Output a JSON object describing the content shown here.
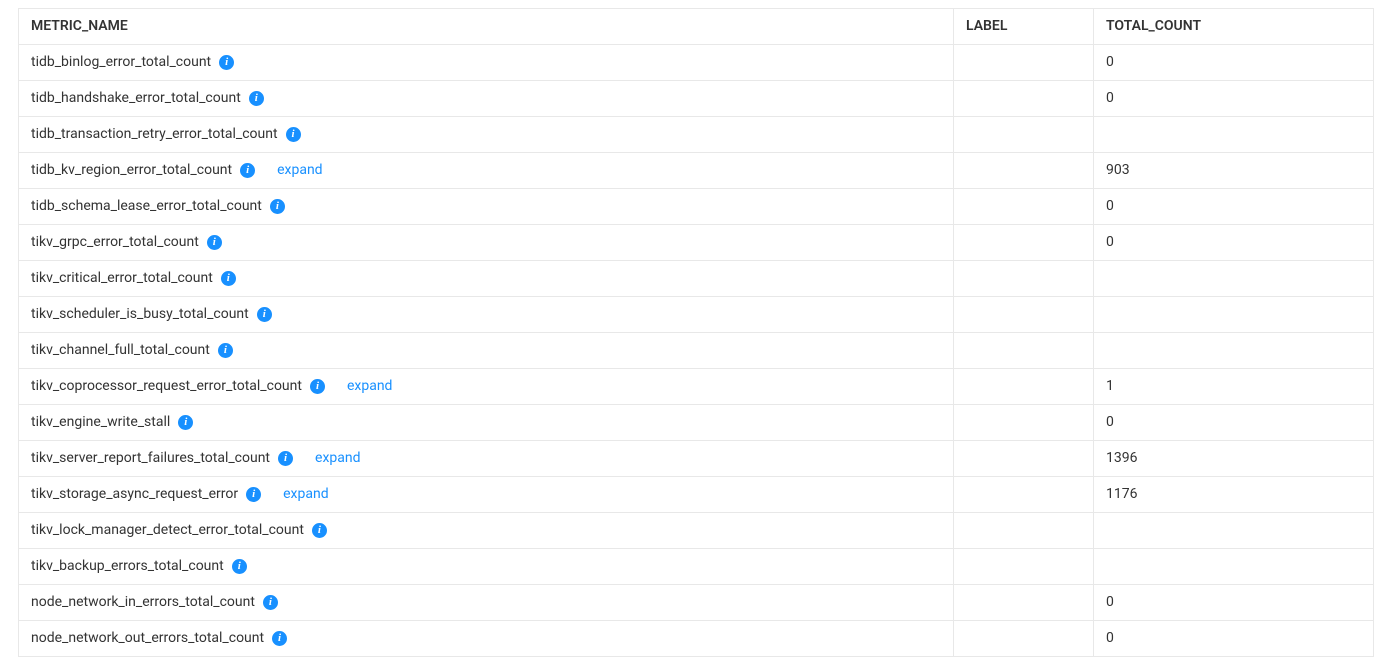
{
  "header": {
    "metric_name": "METRIC_NAME",
    "label": "LABEL",
    "total_count": "TOTAL_COUNT"
  },
  "expand_label": "expand",
  "rows": [
    {
      "metric": "tidb_binlog_error_total_count",
      "label": "",
      "count": "0",
      "expand": false
    },
    {
      "metric": "tidb_handshake_error_total_count",
      "label": "",
      "count": "0",
      "expand": false
    },
    {
      "metric": "tidb_transaction_retry_error_total_count",
      "label": "",
      "count": "",
      "expand": false
    },
    {
      "metric": "tidb_kv_region_error_total_count",
      "label": "",
      "count": "903",
      "expand": true
    },
    {
      "metric": "tidb_schema_lease_error_total_count",
      "label": "",
      "count": "0",
      "expand": false
    },
    {
      "metric": "tikv_grpc_error_total_count",
      "label": "",
      "count": "0",
      "expand": false
    },
    {
      "metric": "tikv_critical_error_total_count",
      "label": "",
      "count": "",
      "expand": false
    },
    {
      "metric": "tikv_scheduler_is_busy_total_count",
      "label": "",
      "count": "",
      "expand": false
    },
    {
      "metric": "tikv_channel_full_total_count",
      "label": "",
      "count": "",
      "expand": false
    },
    {
      "metric": "tikv_coprocessor_request_error_total_count",
      "label": "",
      "count": "1",
      "expand": true
    },
    {
      "metric": "tikv_engine_write_stall",
      "label": "",
      "count": "0",
      "expand": false
    },
    {
      "metric": "tikv_server_report_failures_total_count",
      "label": "",
      "count": "1396",
      "expand": true
    },
    {
      "metric": "tikv_storage_async_request_error",
      "label": "",
      "count": "1176",
      "expand": true
    },
    {
      "metric": "tikv_lock_manager_detect_error_total_count",
      "label": "",
      "count": "",
      "expand": false
    },
    {
      "metric": "tikv_backup_errors_total_count",
      "label": "",
      "count": "",
      "expand": false
    },
    {
      "metric": "node_network_in_errors_total_count",
      "label": "",
      "count": "0",
      "expand": false
    },
    {
      "metric": "node_network_out_errors_total_count",
      "label": "",
      "count": "0",
      "expand": false
    }
  ]
}
